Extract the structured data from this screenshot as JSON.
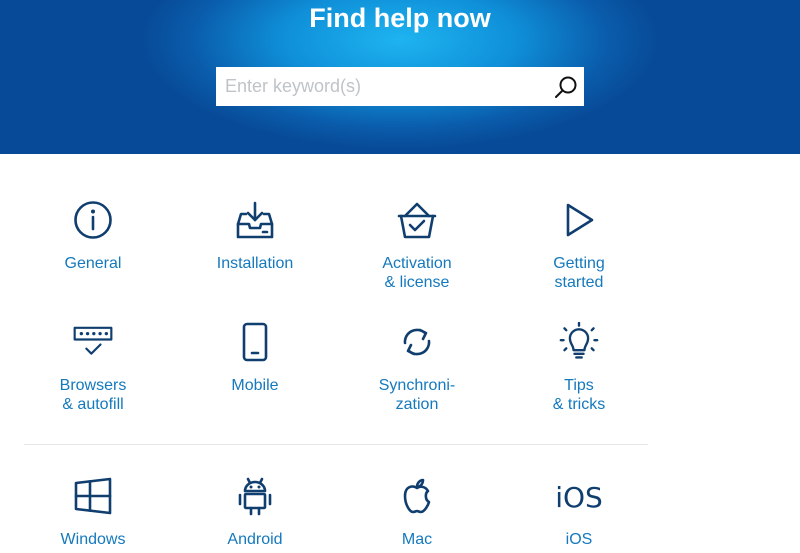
{
  "hero": {
    "title": "Find help now"
  },
  "search": {
    "placeholder": "Enter keyword(s)",
    "value": ""
  },
  "categories": [
    {
      "label": "General",
      "icon": "info-icon"
    },
    {
      "label": "Installation",
      "icon": "download-tray-icon"
    },
    {
      "label": "Activation\n& license",
      "icon": "basket-check-icon"
    },
    {
      "label": "Getting\nstarted",
      "icon": "play-icon"
    },
    {
      "label": "Browsers\n& autofill",
      "icon": "password-field-check-icon"
    },
    {
      "label": "Mobile",
      "icon": "smartphone-icon"
    },
    {
      "label": "Synchroni-\nzation",
      "icon": "sync-icon"
    },
    {
      "label": "Tips\n& tricks",
      "icon": "lightbulb-icon"
    }
  ],
  "platforms": [
    {
      "label": "Windows",
      "icon": "windows-icon"
    },
    {
      "label": "Android",
      "icon": "android-icon"
    },
    {
      "label": "Mac",
      "icon": "apple-icon"
    },
    {
      "label": "iOS",
      "icon": "ios-icon",
      "icon_text": "iOS"
    }
  ],
  "colors": {
    "hero_dark": "#074a97",
    "hero_light": "#1eb4f0",
    "link": "#1479bd",
    "icon": "#0f3e6f"
  }
}
